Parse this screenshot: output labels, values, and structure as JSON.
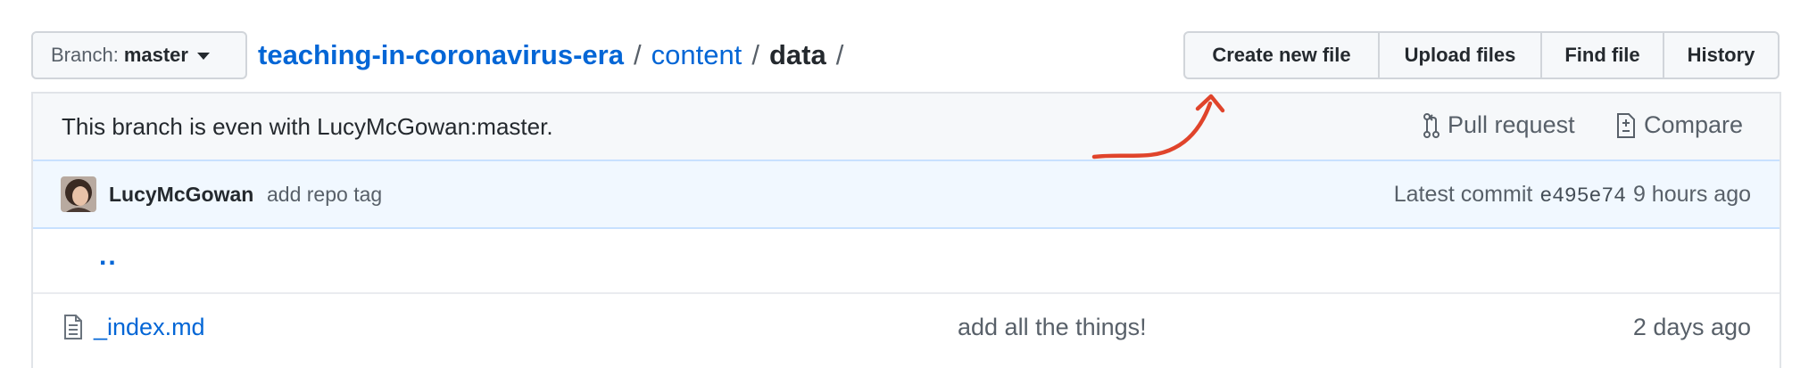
{
  "branch_selector": {
    "prefix": "Branch:",
    "name": "master"
  },
  "breadcrumb": {
    "repo": "teaching-in-coronavirus-era",
    "sep1": "/",
    "dir": "content",
    "sep2": "/",
    "current": "data",
    "sep3": "/"
  },
  "file_actions": [
    {
      "label": "Create new file",
      "name": "create-new-file-button"
    },
    {
      "label": "Upload files",
      "name": "upload-files-button"
    },
    {
      "label": "Find file",
      "name": "find-file-button"
    },
    {
      "label": "History",
      "name": "history-button"
    }
  ],
  "branch_info": {
    "message": "This branch is even with LucyMcGowan:master.",
    "pull_request": "Pull request",
    "compare": "Compare"
  },
  "latest_commit": {
    "author": "LucyMcGowan",
    "message": "add repo tag",
    "label": "Latest commit",
    "sha": "e495e74",
    "age": "9 hours ago"
  },
  "files": {
    "up_link": "..",
    "rows": [
      {
        "name": "_index.md",
        "message": "add all the things!",
        "age": "2 days ago",
        "icon": "file-icon"
      }
    ]
  },
  "annotation": {
    "color": "#e0442b",
    "icon": "hand-drawn-arrow"
  }
}
